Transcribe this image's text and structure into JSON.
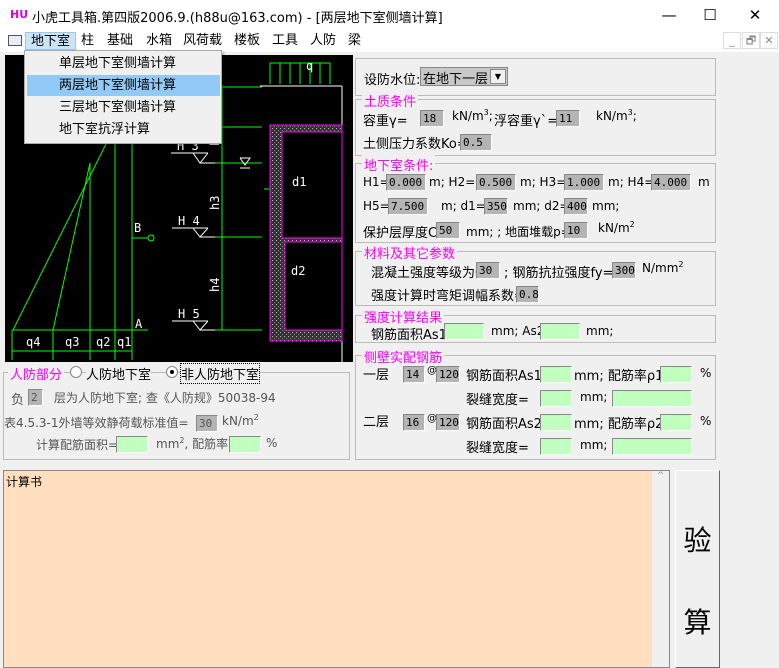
{
  "window": {
    "logo": "HU",
    "title": "小虎工具箱.第四版2006.9.(h88u@163.com) - [两层地下室侧墙计算]",
    "minimize": "—",
    "maximize": "☐",
    "close": "✕"
  },
  "menu": {
    "items": [
      "地下室",
      "柱",
      "基础",
      "水箱",
      "风荷载",
      "楼板",
      "工具",
      "人防",
      "梁"
    ],
    "mdi": [
      "_",
      "🗗",
      "✕"
    ]
  },
  "dropdown": [
    "单层地下室侧墙计算",
    "两层地下室侧墙计算",
    "三层地下室侧墙计算",
    "地下室抗浮计算"
  ],
  "drawing": {
    "q": "q",
    "H3": "H 3",
    "H4": "H 4",
    "H5": "H 5",
    "h3": "h3",
    "h4": "h4",
    "h": "h",
    "d1": "d1",
    "d2": "d2",
    "A": "A",
    "B": "B",
    "q1": "q1",
    "q2": "q2",
    "q3": "q3",
    "q4": "q4"
  },
  "water": {
    "label": "设防水位:",
    "value": "在地下一层"
  },
  "soil": {
    "title": "土质条件",
    "gamma_label": "容重γ=",
    "gamma": "18",
    "unit1": "kN/m",
    "sup": "3",
    "sep": ";",
    "gamma2_label": "浮容重γ`=",
    "gamma2": "11",
    "unit2": "kN/m",
    "ko_label": "土侧压力系数Ko=",
    "ko": "0.5"
  },
  "basement": {
    "title": "地下室条件:",
    "H1_label": "H1=",
    "H1": "0.000",
    "H2_label": "m; H2=-",
    "H2": "0.500",
    "H3_label": "m; H3=-",
    "H3": "1.000",
    "H4_label": "m; H4=-",
    "H4": "4.000",
    "m": "m",
    "H5_label": "H5=-",
    "H5": "7.500",
    "d1_label": "m; d1=",
    "d1": "350",
    "d2_label": "mm; d2=",
    "d2": "400",
    "mm": "mm;",
    "c_label": "保护层厚度C=",
    "c": "50",
    "p_label": "mm; ; 地面堆载p=",
    "p": "10",
    "p_unit": "kN/m",
    "p_sup": "2"
  },
  "material": {
    "title": "材料及其它参数",
    "c_label": "混凝土强度等级为C",
    "c": "30",
    "fy_label": "; 钢筋抗拉强度fy=",
    "fy": "300",
    "fy_unit": "N/mm",
    "sup": "2",
    "coef_label": "强度计算时弯矩调幅系数=",
    "coef": "0.8"
  },
  "result": {
    "title": "强度计算结果",
    "as1_label": "钢筋面积As1=",
    "as2_label": "mm; As2=",
    "mm": "mm;"
  },
  "rebar": {
    "title": "侧壁实配钢筋",
    "layer1": "一层",
    "d1": "14",
    "at": "@",
    "s1": "120",
    "area1": "钢筋面积As1=",
    "rho1": "mm; 配筋率ρ1=",
    "pct": "%",
    "crack": "裂缝宽度=",
    "mm": "mm;",
    "layer2": "二层",
    "d2": "16",
    "s2": "120",
    "area2": "钢筋面积As2=",
    "rho2": "mm; 配筋率ρ2="
  },
  "civil": {
    "title": "人防部分",
    "opt1": "人防地下室",
    "opt2": "非人防地下室",
    "selected": "opt2",
    "neg": "负",
    "floors": "2",
    "desc": "层为人防地下室; 查《人防规》50038-94",
    "table": "表4.5.3-1外墙等效静荷载标准值=",
    "load": "30",
    "unit": "kN/m",
    "sup": "2",
    "calc_area": "计算配筋面积=",
    "mm2": "mm",
    "sep": ", 配筋率=",
    "pct": "%"
  },
  "calcbook": {
    "text": "计算书",
    "scroll_up": "^"
  },
  "verify": {
    "c1": "验",
    "c2": "算"
  }
}
